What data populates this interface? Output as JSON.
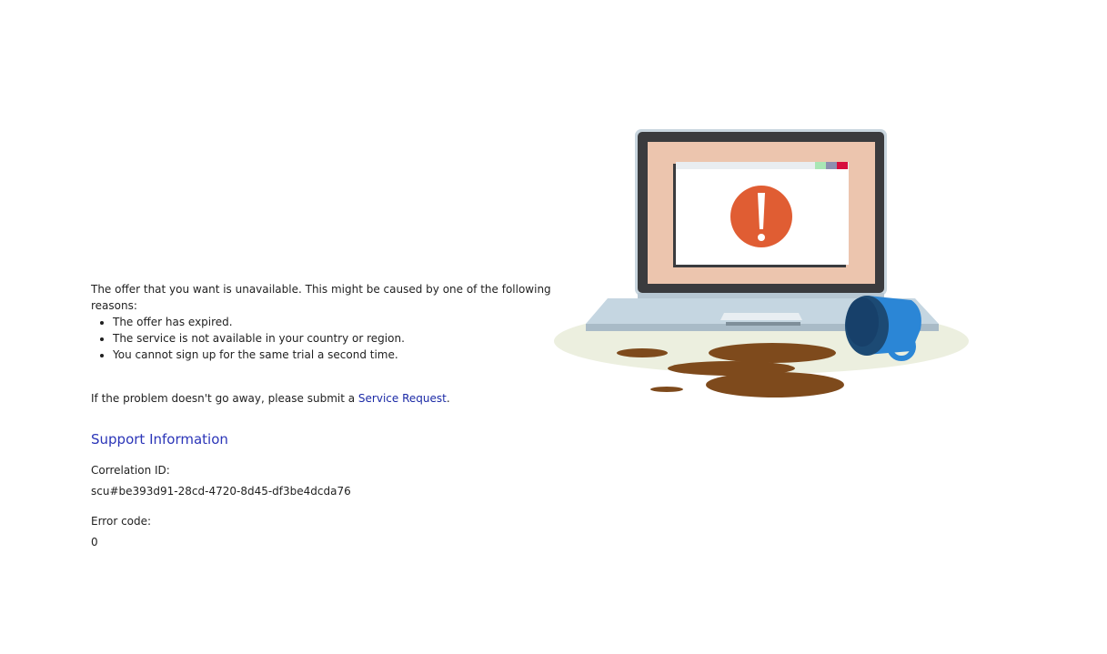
{
  "message": {
    "intro": "The offer that you want is unavailable. This might be caused by one of the following reasons:",
    "reasons": [
      "The offer has expired.",
      "The service is not available in your country or region.",
      "You cannot sign up for the same trial a second time."
    ],
    "request_prefix": "If the problem doesn't go away, please submit a ",
    "request_link": "Service Request",
    "request_suffix": "."
  },
  "support": {
    "heading": "Support Information",
    "correlation_label": "Correlation ID:",
    "correlation_value": "scu#be393d91-28cd-4720-8d45-df3be4dcda76",
    "error_label": "Error code:",
    "error_value": "0"
  },
  "illustration": {
    "subject": "laptop-with-error-and-spilled-coffee",
    "colors": {
      "screen_bg": "#ecc5ae",
      "alert_circle": "#e05d33",
      "mug": "#2b86d6",
      "coffee": "#7e4a1c",
      "laptop_frame": "#3a3b3e"
    }
  }
}
